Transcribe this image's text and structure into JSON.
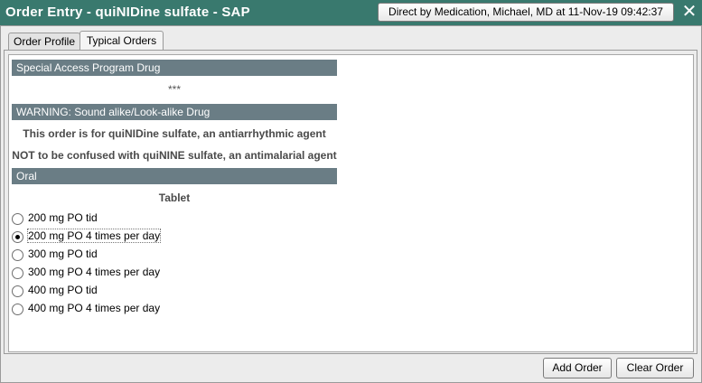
{
  "window": {
    "title": "Order Entry - quiNIDine sulfate - SAP",
    "provider_button": "Direct by Medication, Michael, MD at 11-Nov-19 09:42:37",
    "close_glyph": "✕"
  },
  "tabs": [
    {
      "label": "Order Profile",
      "selected": false
    },
    {
      "label": "Typical Orders",
      "selected": true
    }
  ],
  "sections": {
    "special_access": {
      "header": "Special Access Program Drug",
      "note": "***"
    },
    "warning": {
      "header": "WARNING: Sound alike/Look-alike Drug",
      "line1": "This order is for quiNIDine sulfate, an antiarrhythmic agent",
      "line2": "NOT to be confused with quiNINE sulfate, an antimalarial agent"
    },
    "oral": {
      "header": "Oral",
      "form": "Tablet"
    }
  },
  "orders": [
    {
      "label": "200 mg PO tid",
      "selected": false
    },
    {
      "label": "200 mg PO 4 times per day",
      "selected": true
    },
    {
      "label": "300 mg PO tid",
      "selected": false
    },
    {
      "label": "300 mg PO 4 times per day",
      "selected": false
    },
    {
      "label": "400 mg PO tid",
      "selected": false
    },
    {
      "label": "400 mg PO 4 times per day",
      "selected": false
    }
  ],
  "footer": {
    "add_order": "Add Order",
    "clear_order": "Clear Order"
  },
  "colors": {
    "titlebar": "#39796e",
    "section_header": "#6a7d85"
  }
}
